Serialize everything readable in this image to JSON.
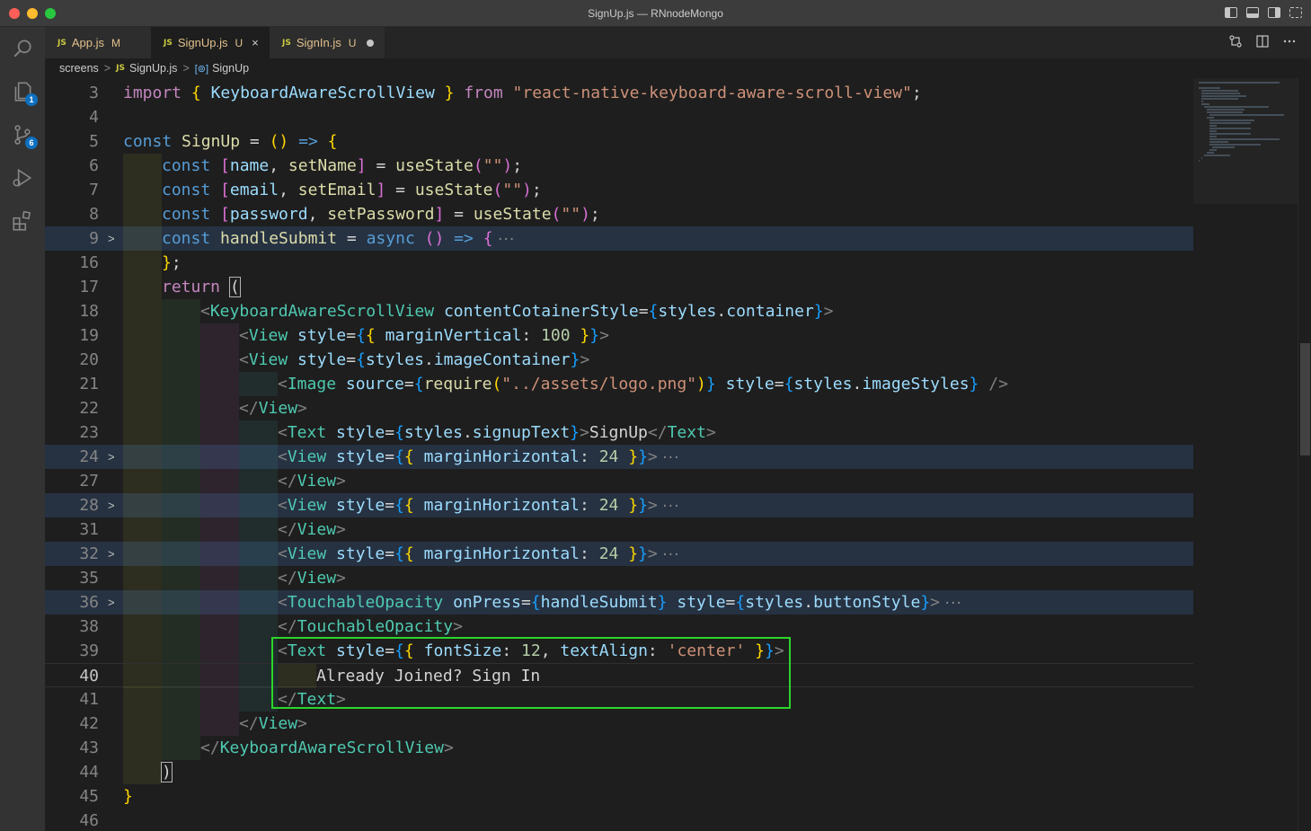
{
  "window": {
    "title": "SignUp.js — RNnodeMongo"
  },
  "activity_bar": {
    "explorer_badge": "1",
    "scm_badge": "6"
  },
  "tabs": [
    {
      "label": "App.js",
      "status": "M",
      "state": "inactive",
      "closer": ""
    },
    {
      "label": "SignUp.js",
      "status": "U",
      "state": "active",
      "closer": "×"
    },
    {
      "label": "SignIn.js",
      "status": "U",
      "state": "modified",
      "closer": ""
    }
  ],
  "tab_icon_text": "JS",
  "breadcrumb": {
    "folder": "screens",
    "file": "SignUp.js",
    "symbol": "SignUp",
    "symbol_icon": "[⊚]",
    "separator": ">"
  },
  "editor": {
    "active_line": "40",
    "lines": [
      {
        "n": "3",
        "fold": "",
        "hl": false,
        "indent": 0
      },
      {
        "n": "4",
        "fold": "",
        "hl": false,
        "indent": 0
      },
      {
        "n": "5",
        "fold": "",
        "hl": false,
        "indent": 0
      },
      {
        "n": "6",
        "fold": "",
        "hl": false,
        "indent": 1
      },
      {
        "n": "7",
        "fold": "",
        "hl": false,
        "indent": 1
      },
      {
        "n": "8",
        "fold": "",
        "hl": false,
        "indent": 1
      },
      {
        "n": "9",
        "fold": ">",
        "hl": true,
        "indent": 1
      },
      {
        "n": "16",
        "fold": "",
        "hl": false,
        "indent": 1
      },
      {
        "n": "17",
        "fold": "",
        "hl": false,
        "indent": 1
      },
      {
        "n": "18",
        "fold": "",
        "hl": false,
        "indent": 2
      },
      {
        "n": "19",
        "fold": "",
        "hl": false,
        "indent": 3
      },
      {
        "n": "20",
        "fold": "",
        "hl": false,
        "indent": 3
      },
      {
        "n": "21",
        "fold": "",
        "hl": false,
        "indent": 4
      },
      {
        "n": "22",
        "fold": "",
        "hl": false,
        "indent": 3
      },
      {
        "n": "23",
        "fold": "",
        "hl": false,
        "indent": 4
      },
      {
        "n": "24",
        "fold": ">",
        "hl": true,
        "indent": 4
      },
      {
        "n": "27",
        "fold": "",
        "hl": false,
        "indent": 4
      },
      {
        "n": "28",
        "fold": ">",
        "hl": true,
        "indent": 4
      },
      {
        "n": "31",
        "fold": "",
        "hl": false,
        "indent": 4
      },
      {
        "n": "32",
        "fold": ">",
        "hl": true,
        "indent": 4
      },
      {
        "n": "35",
        "fold": "",
        "hl": false,
        "indent": 4
      },
      {
        "n": "36",
        "fold": ">",
        "hl": true,
        "indent": 4
      },
      {
        "n": "38",
        "fold": "",
        "hl": false,
        "indent": 4
      },
      {
        "n": "39",
        "fold": "",
        "hl": false,
        "indent": 4
      },
      {
        "n": "40",
        "fold": "",
        "hl": false,
        "indent": 5
      },
      {
        "n": "41",
        "fold": "",
        "hl": false,
        "indent": 4
      },
      {
        "n": "42",
        "fold": "",
        "hl": false,
        "indent": 3
      },
      {
        "n": "43",
        "fold": "",
        "hl": false,
        "indent": 2
      },
      {
        "n": "44",
        "fold": "",
        "hl": false,
        "indent": 1
      },
      {
        "n": "45",
        "fold": "",
        "hl": false,
        "indent": 0
      },
      {
        "n": "46",
        "fold": "",
        "hl": false,
        "indent": 0
      }
    ],
    "code": [
      [
        [
          "kw-c",
          "import"
        ],
        [
          "txt",
          " "
        ],
        [
          "br1",
          "{"
        ],
        [
          "txt",
          " "
        ],
        [
          "var",
          "KeyboardAwareScrollView"
        ],
        [
          "txt",
          " "
        ],
        [
          "br1",
          "}"
        ],
        [
          "txt",
          " "
        ],
        [
          "kw-c",
          "from"
        ],
        [
          "txt",
          " "
        ],
        [
          "str",
          "\"react-native-keyboard-aware-scroll-view\""
        ],
        [
          "txt",
          ";"
        ]
      ],
      [],
      [
        [
          "kw-b",
          "const"
        ],
        [
          "txt",
          " "
        ],
        [
          "fn",
          "SignUp"
        ],
        [
          "txt",
          " = "
        ],
        [
          "br1",
          "()"
        ],
        [
          "txt",
          " "
        ],
        [
          "kw-b",
          "=>"
        ],
        [
          "txt",
          " "
        ],
        [
          "br1",
          "{"
        ]
      ],
      [
        [
          "kw-b",
          "const"
        ],
        [
          "txt",
          " "
        ],
        [
          "br2",
          "["
        ],
        [
          "var",
          "name"
        ],
        [
          "txt",
          ", "
        ],
        [
          "fn",
          "setName"
        ],
        [
          "br2",
          "]"
        ],
        [
          "txt",
          " = "
        ],
        [
          "fn",
          "useState"
        ],
        [
          "br2",
          "("
        ],
        [
          "str",
          "\"\""
        ],
        [
          "br2",
          ")"
        ],
        [
          "txt",
          ";"
        ]
      ],
      [
        [
          "kw-b",
          "const"
        ],
        [
          "txt",
          " "
        ],
        [
          "br2",
          "["
        ],
        [
          "var",
          "email"
        ],
        [
          "txt",
          ", "
        ],
        [
          "fn",
          "setEmail"
        ],
        [
          "br2",
          "]"
        ],
        [
          "txt",
          " = "
        ],
        [
          "fn",
          "useState"
        ],
        [
          "br2",
          "("
        ],
        [
          "str",
          "\"\""
        ],
        [
          "br2",
          ")"
        ],
        [
          "txt",
          ";"
        ]
      ],
      [
        [
          "kw-b",
          "const"
        ],
        [
          "txt",
          " "
        ],
        [
          "br2",
          "["
        ],
        [
          "var",
          "password"
        ],
        [
          "txt",
          ", "
        ],
        [
          "fn",
          "setPassword"
        ],
        [
          "br2",
          "]"
        ],
        [
          "txt",
          " = "
        ],
        [
          "fn",
          "useState"
        ],
        [
          "br2",
          "("
        ],
        [
          "str",
          "\"\""
        ],
        [
          "br2",
          ")"
        ],
        [
          "txt",
          ";"
        ]
      ],
      [
        [
          "kw-b",
          "const"
        ],
        [
          "txt",
          " "
        ],
        [
          "fn",
          "handleSubmit"
        ],
        [
          "txt",
          " = "
        ],
        [
          "kw-b",
          "async"
        ],
        [
          "txt",
          " "
        ],
        [
          "br2",
          "()"
        ],
        [
          "txt",
          " "
        ],
        [
          "kw-b",
          "=>"
        ],
        [
          "txt",
          " "
        ],
        [
          "br2",
          "{"
        ],
        [
          "ellipsis",
          "···"
        ]
      ],
      [
        [
          "br1",
          "}"
        ],
        [
          "txt",
          ";"
        ]
      ],
      [
        [
          "kw-c",
          "return"
        ],
        [
          "txt",
          " "
        ],
        [
          "bm",
          "("
        ]
      ],
      [
        [
          "ang",
          "<"
        ],
        [
          "tag",
          "KeyboardAwareScrollView"
        ],
        [
          "txt",
          " "
        ],
        [
          "var",
          "contentCotainerStyle"
        ],
        [
          "txt",
          "="
        ],
        [
          "br3",
          "{"
        ],
        [
          "var",
          "styles"
        ],
        [
          "txt",
          "."
        ],
        [
          "var",
          "container"
        ],
        [
          "br3",
          "}"
        ],
        [
          "ang",
          ">"
        ]
      ],
      [
        [
          "ang",
          "<"
        ],
        [
          "tag",
          "View"
        ],
        [
          "txt",
          " "
        ],
        [
          "var",
          "style"
        ],
        [
          "txt",
          "="
        ],
        [
          "br3",
          "{"
        ],
        [
          "br1",
          "{"
        ],
        [
          "txt",
          " "
        ],
        [
          "var",
          "marginVertical"
        ],
        [
          "txt",
          ": "
        ],
        [
          "num",
          "100"
        ],
        [
          "txt",
          " "
        ],
        [
          "br1",
          "}"
        ],
        [
          "br3",
          "}"
        ],
        [
          "ang",
          ">"
        ]
      ],
      [
        [
          "ang",
          "<"
        ],
        [
          "tag",
          "View"
        ],
        [
          "txt",
          " "
        ],
        [
          "var",
          "style"
        ],
        [
          "txt",
          "="
        ],
        [
          "br3",
          "{"
        ],
        [
          "var",
          "styles"
        ],
        [
          "txt",
          "."
        ],
        [
          "var",
          "imageContainer"
        ],
        [
          "br3",
          "}"
        ],
        [
          "ang",
          ">"
        ]
      ],
      [
        [
          "ang",
          "<"
        ],
        [
          "tag",
          "Image"
        ],
        [
          "txt",
          " "
        ],
        [
          "var",
          "source"
        ],
        [
          "txt",
          "="
        ],
        [
          "br3",
          "{"
        ],
        [
          "fn",
          "require"
        ],
        [
          "br1",
          "("
        ],
        [
          "str",
          "\"../assets/logo.png\""
        ],
        [
          "br1",
          ")"
        ],
        [
          "br3",
          "}"
        ],
        [
          "txt",
          " "
        ],
        [
          "var",
          "style"
        ],
        [
          "txt",
          "="
        ],
        [
          "br3",
          "{"
        ],
        [
          "var",
          "styles"
        ],
        [
          "txt",
          "."
        ],
        [
          "var",
          "imageStyles"
        ],
        [
          "br3",
          "}"
        ],
        [
          "txt",
          " "
        ],
        [
          "ang",
          "/>"
        ]
      ],
      [
        [
          "ang",
          "</"
        ],
        [
          "tag",
          "View"
        ],
        [
          "ang",
          ">"
        ]
      ],
      [
        [
          "ang",
          "<"
        ],
        [
          "tag",
          "Text"
        ],
        [
          "txt",
          " "
        ],
        [
          "var",
          "style"
        ],
        [
          "txt",
          "="
        ],
        [
          "br3",
          "{"
        ],
        [
          "var",
          "styles"
        ],
        [
          "txt",
          "."
        ],
        [
          "var",
          "signupText"
        ],
        [
          "br3",
          "}"
        ],
        [
          "ang",
          ">"
        ],
        [
          "txt",
          "SignUp"
        ],
        [
          "ang",
          "</"
        ],
        [
          "tag",
          "Text"
        ],
        [
          "ang",
          ">"
        ]
      ],
      [
        [
          "ang",
          "<"
        ],
        [
          "tag",
          "View"
        ],
        [
          "txt",
          " "
        ],
        [
          "var",
          "style"
        ],
        [
          "txt",
          "="
        ],
        [
          "br3",
          "{"
        ],
        [
          "br1",
          "{"
        ],
        [
          "txt",
          " "
        ],
        [
          "var",
          "marginHorizontal"
        ],
        [
          "txt",
          ": "
        ],
        [
          "num",
          "24"
        ],
        [
          "txt",
          " "
        ],
        [
          "br1",
          "}"
        ],
        [
          "br3",
          "}"
        ],
        [
          "ang",
          ">"
        ],
        [
          "ellipsis",
          "···"
        ]
      ],
      [
        [
          "ang",
          "</"
        ],
        [
          "tag",
          "View"
        ],
        [
          "ang",
          ">"
        ]
      ],
      [
        [
          "ang",
          "<"
        ],
        [
          "tag",
          "View"
        ],
        [
          "txt",
          " "
        ],
        [
          "var",
          "style"
        ],
        [
          "txt",
          "="
        ],
        [
          "br3",
          "{"
        ],
        [
          "br1",
          "{"
        ],
        [
          "txt",
          " "
        ],
        [
          "var",
          "marginHorizontal"
        ],
        [
          "txt",
          ": "
        ],
        [
          "num",
          "24"
        ],
        [
          "txt",
          " "
        ],
        [
          "br1",
          "}"
        ],
        [
          "br3",
          "}"
        ],
        [
          "ang",
          ">"
        ],
        [
          "ellipsis",
          "···"
        ]
      ],
      [
        [
          "ang",
          "</"
        ],
        [
          "tag",
          "View"
        ],
        [
          "ang",
          ">"
        ]
      ],
      [
        [
          "ang",
          "<"
        ],
        [
          "tag",
          "View"
        ],
        [
          "txt",
          " "
        ],
        [
          "var",
          "style"
        ],
        [
          "txt",
          "="
        ],
        [
          "br3",
          "{"
        ],
        [
          "br1",
          "{"
        ],
        [
          "txt",
          " "
        ],
        [
          "var",
          "marginHorizontal"
        ],
        [
          "txt",
          ": "
        ],
        [
          "num",
          "24"
        ],
        [
          "txt",
          " "
        ],
        [
          "br1",
          "}"
        ],
        [
          "br3",
          "}"
        ],
        [
          "ang",
          ">"
        ],
        [
          "ellipsis",
          "···"
        ]
      ],
      [
        [
          "ang",
          "</"
        ],
        [
          "tag",
          "View"
        ],
        [
          "ang",
          ">"
        ]
      ],
      [
        [
          "ang",
          "<"
        ],
        [
          "tag",
          "TouchableOpacity"
        ],
        [
          "txt",
          " "
        ],
        [
          "var",
          "onPress"
        ],
        [
          "txt",
          "="
        ],
        [
          "br3",
          "{"
        ],
        [
          "var",
          "handleSubmit"
        ],
        [
          "br3",
          "}"
        ],
        [
          "txt",
          " "
        ],
        [
          "var",
          "style"
        ],
        [
          "txt",
          "="
        ],
        [
          "br3",
          "{"
        ],
        [
          "var",
          "styles"
        ],
        [
          "txt",
          "."
        ],
        [
          "var",
          "buttonStyle"
        ],
        [
          "br3",
          "}"
        ],
        [
          "ang",
          ">"
        ],
        [
          "ellipsis",
          "···"
        ]
      ],
      [
        [
          "ang",
          "</"
        ],
        [
          "tag",
          "TouchableOpacity"
        ],
        [
          "ang",
          ">"
        ]
      ],
      [
        [
          "ang",
          "<"
        ],
        [
          "tag",
          "Text"
        ],
        [
          "txt",
          " "
        ],
        [
          "var",
          "style"
        ],
        [
          "txt",
          "="
        ],
        [
          "br3",
          "{"
        ],
        [
          "br1",
          "{"
        ],
        [
          "txt",
          " "
        ],
        [
          "var",
          "fontSize"
        ],
        [
          "txt",
          ": "
        ],
        [
          "num",
          "12"
        ],
        [
          "txt",
          ", "
        ],
        [
          "var",
          "textAlign"
        ],
        [
          "txt",
          ": "
        ],
        [
          "str",
          "'center'"
        ],
        [
          "txt",
          " "
        ],
        [
          "br1",
          "}"
        ],
        [
          "br3",
          "}"
        ],
        [
          "ang",
          ">"
        ]
      ],
      [
        [
          "txt",
          "Already Joined? Sign In"
        ]
      ],
      [
        [
          "ang",
          "</"
        ],
        [
          "tag",
          "Text"
        ],
        [
          "ang",
          ">"
        ]
      ],
      [
        [
          "ang",
          "</"
        ],
        [
          "tag",
          "View"
        ],
        [
          "ang",
          ">"
        ]
      ],
      [
        [
          "ang",
          "</"
        ],
        [
          "tag",
          "KeyboardAwareScrollView"
        ],
        [
          "ang",
          ">"
        ]
      ],
      [
        [
          "bm",
          ")"
        ]
      ],
      [
        [
          "br1",
          "}"
        ]
      ],
      []
    ]
  }
}
